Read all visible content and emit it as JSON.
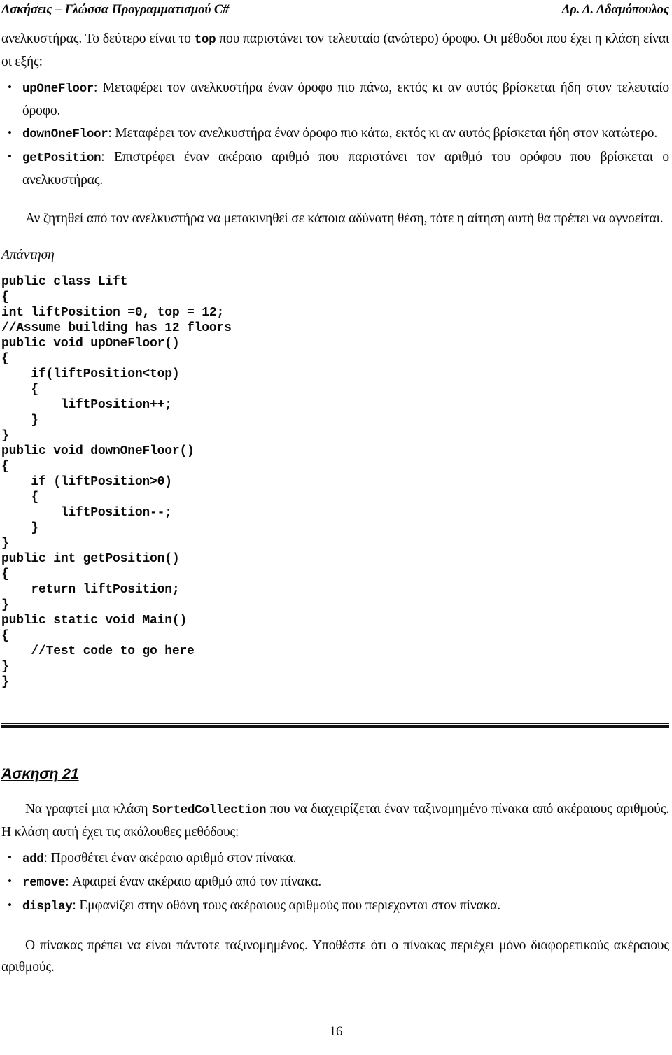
{
  "header": {
    "left": "Ασκήσεις – Γλώσσα Προγραμματισμού C#",
    "right": "Δρ. Δ. Αδαμόπουλος"
  },
  "exercise_20_continued": {
    "intro_part1": "ανελκυστήρας. Το δεύτερο είναι το ",
    "intro_code": "top",
    "intro_part2": " που παριστάνει τον τελευταίο (ανώτερο) όροφο. Οι μέθοδοι που έχει η κλάση είναι οι εξής:",
    "methods": [
      {
        "name": "upOneFloor",
        "description": ": Μεταφέρει τον ανελκυστήρα έναν όροφο πιο πάνω, εκτός κι αν αυτός βρίσκεται ήδη στον τελευταίο όροφο."
      },
      {
        "name": "downOneFloor",
        "description": ": Μεταφέρει τον ανελκυστήρα έναν όροφο πιο κάτω, εκτός κι αν αυτός βρίσκεται ήδη στον κατώτερο."
      },
      {
        "name": "getPosition",
        "description": ": Επιστρέφει έναν ακέραιο αριθμό που παριστάνει τον αριθμό του ορόφου που βρίσκεται ο ανελκυστήρας."
      }
    ],
    "closing_paragraph": "Αν ζητηθεί από τον ανελκυστήρα να μετακινηθεί σε κάποια αδύνατη θέση, τότε η αίτηση αυτή θα πρέπει να αγνοείται.",
    "answer_label": "Απάντηση",
    "code": "public class Lift\n{\nint liftPosition =0, top = 12;\n//Assume building has 12 floors\npublic void upOneFloor()\n{\n    if(liftPosition<top)\n    {\n        liftPosition++;\n    }\n}\npublic void downOneFloor()\n{\n    if (liftPosition>0)\n    {\n        liftPosition--;\n    }\n}\npublic int getPosition()\n{\n    return liftPosition;\n}\npublic static void Main()\n{\n    //Test code to go here\n}\n}"
  },
  "exercise_21": {
    "heading": "Άσκηση 21",
    "intro_part1": "Να γραφτεί μια κλάση ",
    "intro_code": "SortedCollection",
    "intro_part2": " που να διαχειρίζεται έναν ταξινομημένο πίνακα από ακέραιους αριθμούς. Η κλάση αυτή έχει τις ακόλουθες μεθόδους:",
    "methods": [
      {
        "name": "add",
        "description": ": Προσθέτει έναν ακέραιο αριθμό στον πίνακα."
      },
      {
        "name": "remove",
        "description": ": Αφαιρεί έναν ακέραιο αριθμό από τον πίνακα."
      },
      {
        "name": "display",
        "description": ": Εμφανίζει στην οθόνη τους ακέραιους αριθμούς που περιεχονται στον πίνακα."
      }
    ],
    "closing_paragraph": "Ο πίνακας πρέπει να είναι πάντοτε ταξινομημένος. Υποθέστε ότι ο πίνακας περιέχει μόνο διαφορετικούς ακέραιους αριθμούς."
  },
  "footer": {
    "page_number": "16"
  }
}
